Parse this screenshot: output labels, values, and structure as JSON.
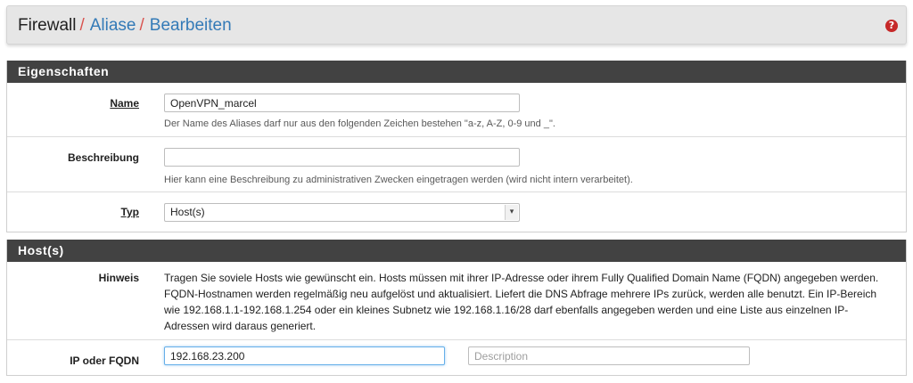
{
  "breadcrumb": {
    "root": "Firewall",
    "separator": "/",
    "items": [
      "Aliase",
      "Bearbeiten"
    ]
  },
  "help_icon": "question-circle-icon",
  "properties": {
    "title": "Eigenschaften",
    "name": {
      "label": "Name",
      "value": "OpenVPN_marcel",
      "help": "Der Name des Aliases darf nur aus den folgenden Zeichen bestehen \"a-z, A-Z, 0-9 und _\"."
    },
    "description": {
      "label": "Beschreibung",
      "value": "",
      "help": "Hier kann eine Beschreibung zu administrativen Zwecken eingetragen werden (wird nicht intern verarbeitet)."
    },
    "type": {
      "label": "Typ",
      "selected": "Host(s)"
    }
  },
  "hosts": {
    "title": "Host(s)",
    "hint": {
      "label": "Hinweis",
      "lines": [
        "Tragen Sie soviele Hosts wie gewünscht ein. Hosts müssen mit ihrer IP-Adresse oder ihrem Fully Qualified Domain Name (FQDN) angegeben werden.",
        "FQDN-Hostnamen werden regelmäßig neu aufgelöst und aktualisiert. Liefert die DNS Abfrage mehrere IPs zurück, werden alle benutzt. Ein IP-Bereich",
        "wie 192.168.1.1-192.168.1.254 oder ein kleines Subnetz wie 192.168.1.16/28 darf ebenfalls angegeben werden und eine Liste aus einzelnen IP-",
        "Adressen wird daraus generiert."
      ]
    },
    "entry": {
      "label": "IP oder FQDN",
      "value": "192.168.23.200",
      "description_placeholder": "Description"
    }
  },
  "colors": {
    "panel_header": "#424242",
    "link": "#337ab7",
    "separator": "#d9534f",
    "help_icon": "#c62828"
  }
}
